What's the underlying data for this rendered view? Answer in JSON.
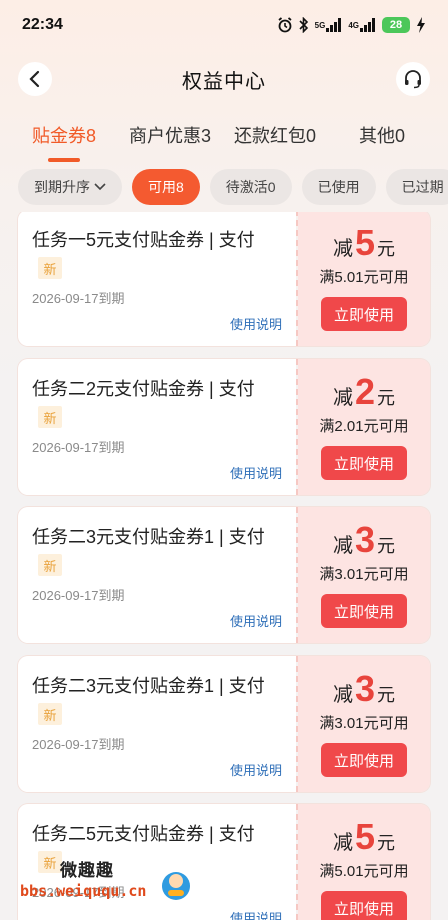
{
  "status_bar": {
    "time": "22:34",
    "signal_label": "5G",
    "signal2_label": "4G",
    "battery": "28"
  },
  "header": {
    "title": "权益中心"
  },
  "tabs": [
    {
      "label": "贴金券8",
      "active": true
    },
    {
      "label": "商户优惠3",
      "active": false
    },
    {
      "label": "还款红包0",
      "active": false
    },
    {
      "label": "其他0",
      "active": false
    }
  ],
  "filters": {
    "sort": "到期升序",
    "chips": [
      "可用8",
      "待激活0",
      "已使用",
      "已过期"
    ]
  },
  "coupons": [
    {
      "title": "任务一5元支付贴金券 | 支付",
      "badge": "新",
      "expiry": "2026-09-17到期",
      "link": "使用说明",
      "prefix": "减",
      "amount": "5",
      "unit": "元",
      "threshold": "满5.01元可用",
      "button": "立即使用"
    },
    {
      "title": "任务二2元支付贴金券 | 支付",
      "badge": "新",
      "expiry": "2026-09-17到期",
      "link": "使用说明",
      "prefix": "减",
      "amount": "2",
      "unit": "元",
      "threshold": "满2.01元可用",
      "button": "立即使用"
    },
    {
      "title": "任务二3元支付贴金券1 | 支付",
      "badge": "新",
      "expiry": "2026-09-17到期",
      "link": "使用说明",
      "prefix": "减",
      "amount": "3",
      "unit": "元",
      "threshold": "满3.01元可用",
      "button": "立即使用"
    },
    {
      "title": "任务二3元支付贴金券1 | 支付",
      "badge": "新",
      "expiry": "2026-09-17到期",
      "link": "使用说明",
      "prefix": "减",
      "amount": "3",
      "unit": "元",
      "threshold": "满3.01元可用",
      "button": "立即使用"
    },
    {
      "title": "任务二5元支付贴金券 | 支付",
      "badge": "新",
      "expiry": "2026-09-17到期",
      "link": "使用说明",
      "prefix": "减",
      "amount": "5",
      "unit": "元",
      "threshold": "满5.01元可用",
      "button": "立即使用"
    }
  ],
  "watermark": {
    "name": "微趣趣",
    "url": "bbs.weiququ.cn"
  },
  "colors": {
    "accent": "#f15a28",
    "coupon_red": "#e8443c",
    "button_red": "#f0484a",
    "link_blue": "#2f6fb8"
  }
}
